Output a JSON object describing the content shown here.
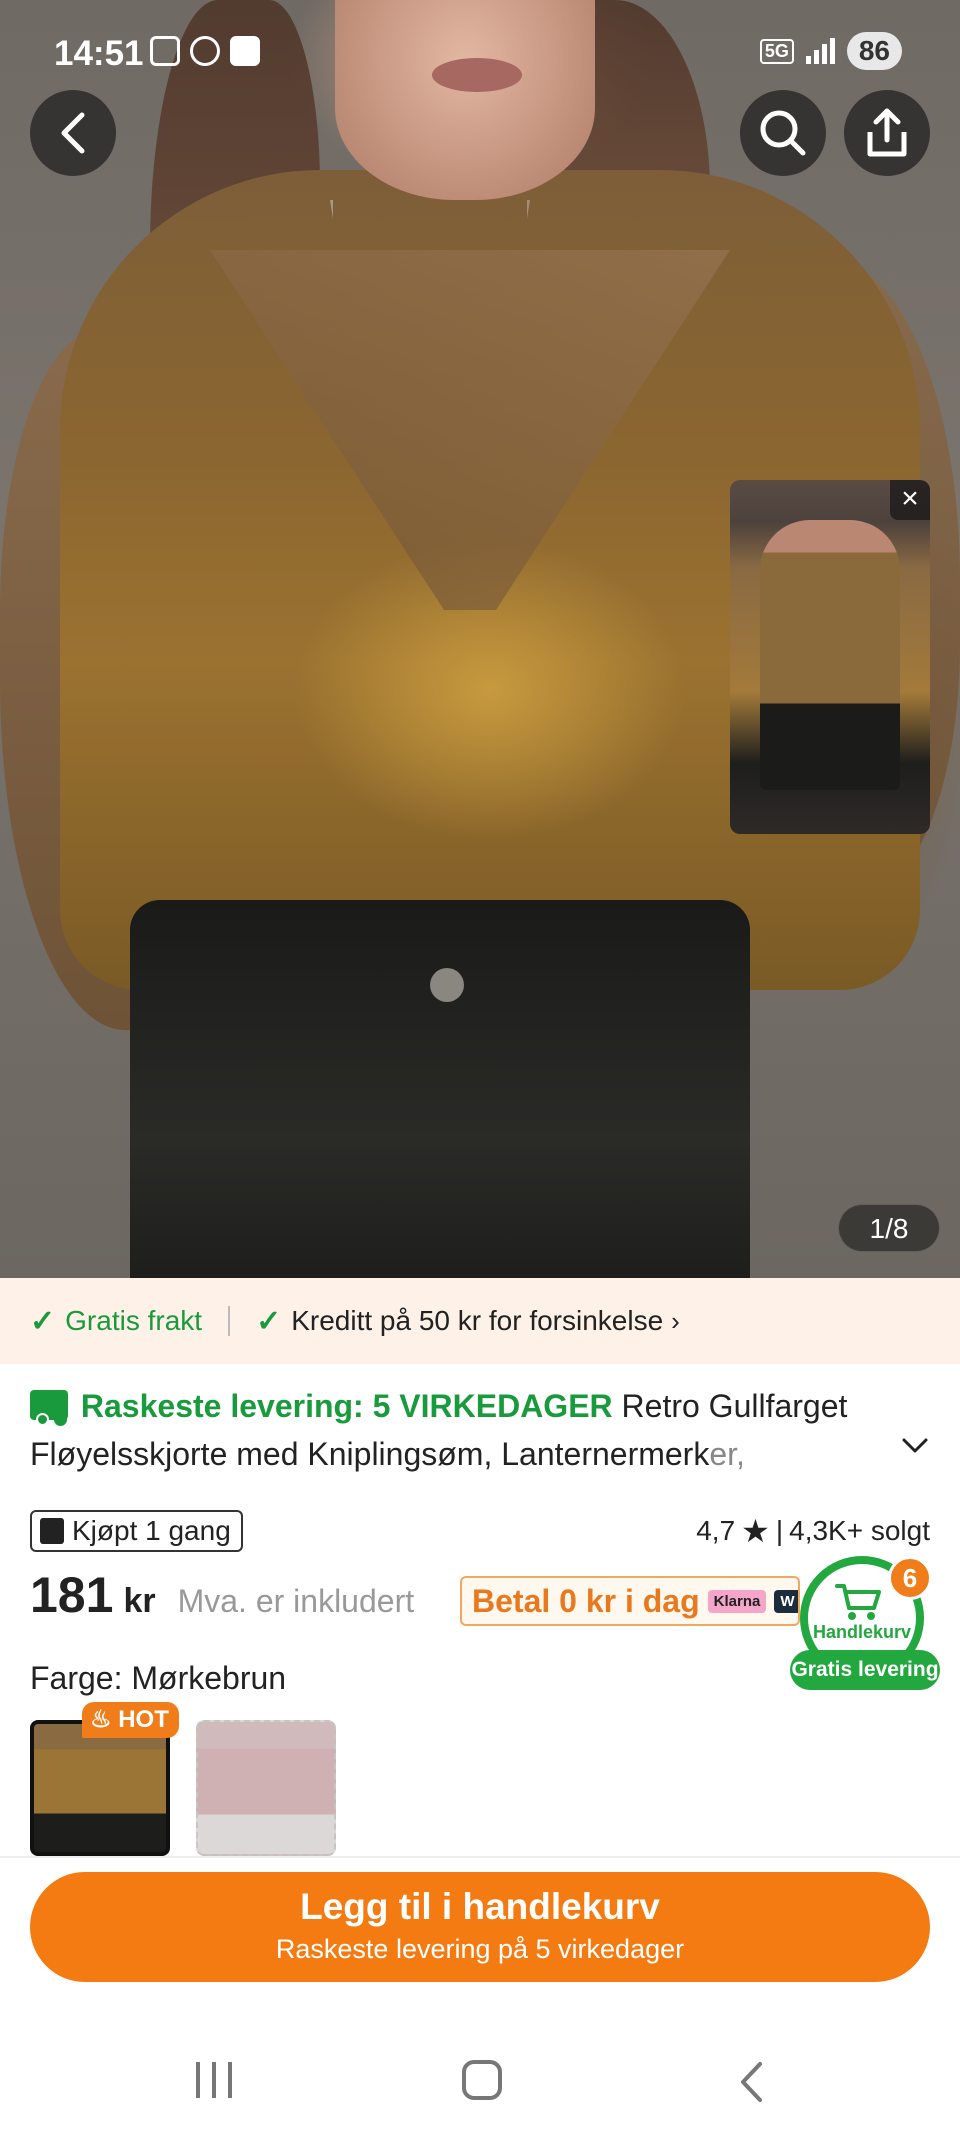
{
  "status_bar": {
    "time": "14:51",
    "network": "5G",
    "battery": "86"
  },
  "gallery": {
    "counter": "1/8"
  },
  "promo": {
    "free_shipping": "Gratis frakt",
    "credit": "Kreditt på 50 kr for forsinkelse"
  },
  "title": {
    "fast_delivery": "Raskeste levering: 5 VIRKEDAGER",
    "product_name_1": "Retro Gullfarget",
    "product_name_2": "Fløyelsskjorte med Kniplingsøm, Lanternermerk",
    "product_name_fade": "er,"
  },
  "stats": {
    "bought": "Kjøpt 1 gang",
    "rating": "4,7",
    "sold": "4,3K+ solgt"
  },
  "price": {
    "amount": "181",
    "currency": "kr",
    "vat": "Mva. er inkludert",
    "klarna_text": "Betal 0 kr i dag",
    "klarna_badge": "Klarna",
    "w_badge": "W"
  },
  "cart": {
    "count": "6",
    "label": "Handlekurv",
    "free_delivery": "Gratis levering"
  },
  "color": {
    "label": "Farge: Mørkebrun",
    "hot_badge": "HOT"
  },
  "cta": {
    "main": "Legg til i handlekurv",
    "sub": "Raskeste levering på 5 virkedager"
  },
  "colors": {
    "accent_orange": "#f47b12",
    "green": "#199a3c",
    "promo_bg": "#fdf1e8"
  },
  "icons": [
    "back-icon",
    "search-icon",
    "share-icon",
    "close-icon",
    "check-icon",
    "truck-icon",
    "chevron-down-icon",
    "bag-icon",
    "star-icon",
    "cart-icon",
    "fire-icon"
  ]
}
